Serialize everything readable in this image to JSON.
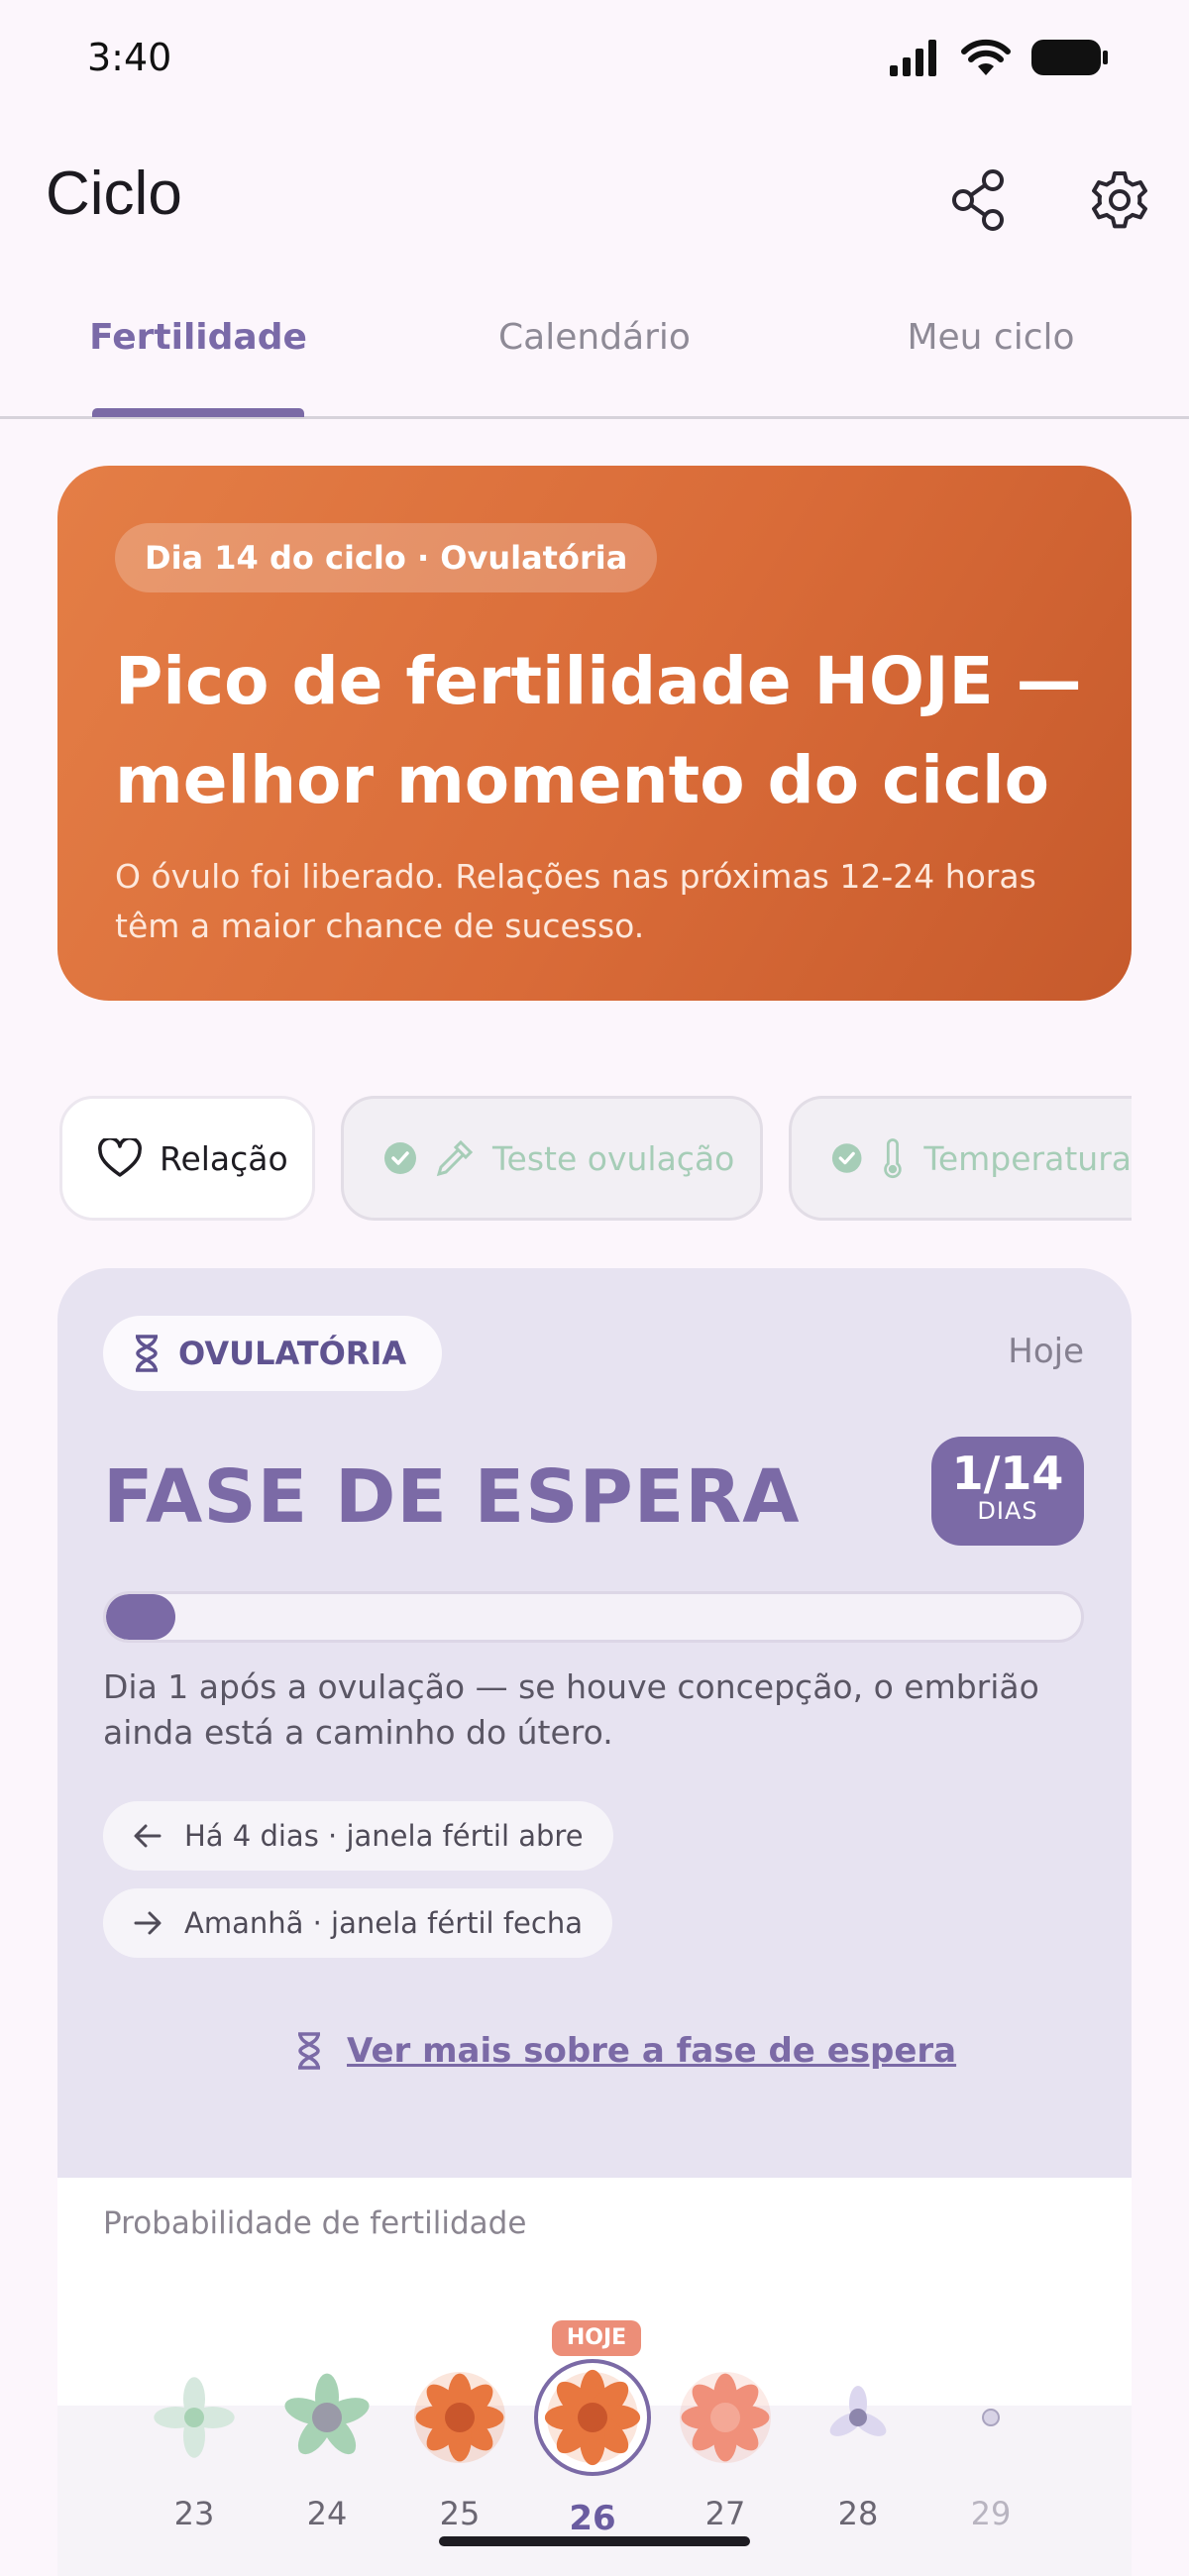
{
  "status_bar": {
    "time": "3:40"
  },
  "header": {
    "title": "Ciclo",
    "share_icon": "share-icon",
    "settings_icon": "gear-icon"
  },
  "tabs": [
    {
      "label": "Fertilidade",
      "active": true
    },
    {
      "label": "Calendário",
      "active": false
    },
    {
      "label": "Meu ciclo",
      "active": false
    }
  ],
  "hero": {
    "badge": "Dia 14 do ciclo · Ovulatória",
    "title": "Pico de fertilidade HOJE — melhor momento do ciclo",
    "description": "O óvulo foi liberado. Relações nas próximas 12-24 horas têm a maior chance de sucesso."
  },
  "actions": [
    {
      "label": "Relação",
      "icon": "heart-icon",
      "done": false
    },
    {
      "label": "Teste ovulação",
      "icon": "dropper-icon",
      "done": true
    },
    {
      "label": "Temperatura",
      "icon": "thermometer-icon",
      "done": true
    }
  ],
  "phase": {
    "badge": "OVULATÓRIA",
    "badge_icon": "hourglass-icon",
    "today": "Hoje",
    "title": "FASE DE ESPERA",
    "days_value": "1/14",
    "days_unit": "DIAS",
    "progress": 0.0714,
    "description": "Dia 1 após a ovulação — se houve concepção, o embrião ainda está a caminho do útero.",
    "previous": "Há 4 dias · janela fértil abre",
    "next": "Amanhã · janela fértil fecha",
    "see_more": "Ver mais sobre a fase de espera"
  },
  "probability": {
    "title": "Probabilidade de fertilidade",
    "today_label": "HOJE",
    "days": [
      {
        "day": "23",
        "level": "low",
        "color": "#d6e8de"
      },
      {
        "day": "24",
        "level": "medium",
        "color": "#a7d2b4"
      },
      {
        "day": "25",
        "level": "high",
        "color": "#e8773f"
      },
      {
        "day": "26",
        "level": "peak",
        "color": "#e8773f",
        "today": true
      },
      {
        "day": "27",
        "level": "high",
        "color": "#f0907a"
      },
      {
        "day": "28",
        "level": "low",
        "color": "#dcd7ef"
      },
      {
        "day": "29",
        "level": "none",
        "color": "#c9c4d8"
      }
    ]
  },
  "colors": {
    "accent": "#7b6aa6",
    "hero": "#e47e46",
    "done_check": "#a6cdb7"
  }
}
